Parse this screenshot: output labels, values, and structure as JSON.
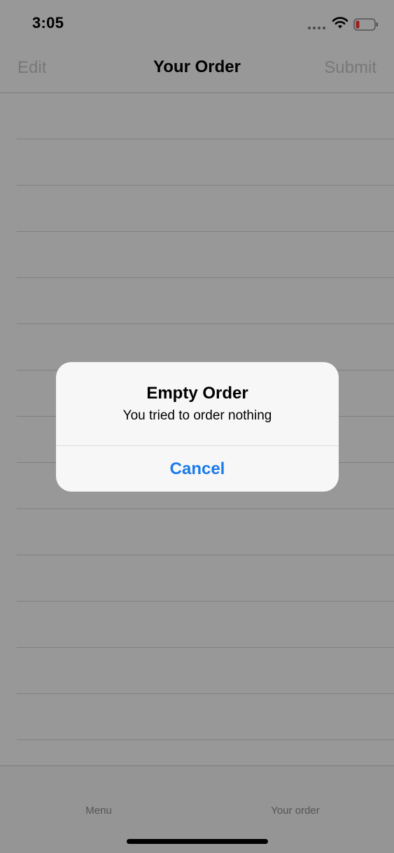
{
  "status_bar": {
    "time": "3:05",
    "icons": [
      "signal-dots-icon",
      "wifi-icon",
      "battery-low-icon"
    ]
  },
  "nav_bar": {
    "edit_label": "Edit",
    "title": "Your Order",
    "submit_label": "Submit"
  },
  "tab_bar": {
    "tabs": [
      {
        "label": "Menu"
      },
      {
        "label": "Your order"
      }
    ]
  },
  "alert": {
    "title": "Empty Order",
    "message": "You tried to order nothing",
    "cancel_label": "Cancel"
  },
  "colors": {
    "accent": "#1a7bea",
    "battery_low": "#ff3b30",
    "overlay": "rgba(0,0,0,0.4)"
  }
}
